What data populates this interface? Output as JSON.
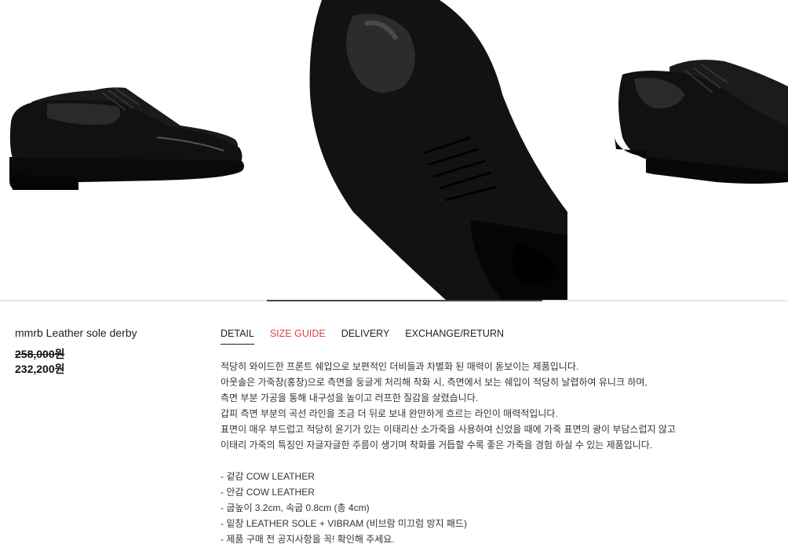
{
  "gallery": {
    "slides": [
      "shoe-side-view",
      "shoe-top-closeup",
      "shoe-angled-view"
    ],
    "progress": 0.35
  },
  "product": {
    "name": "mmrb Leather sole derby",
    "original_price": "258,000원",
    "sale_price": "232,200원"
  },
  "tabs": [
    {
      "label": "DETAIL",
      "active": true
    },
    {
      "label": "SIZE GUIDE",
      "highlight_color": "#d9473f"
    },
    {
      "label": "DELIVERY"
    },
    {
      "label": "EXCHANGE/RETURN"
    }
  ],
  "description": {
    "paragraphs": [
      "적당히 와이드한 프론트 쉐입으로 보편적인 더비들과 차별화 된 매력이 돋보이는 제품입니다.",
      "아웃솔은 가죽창(홍창)으로 측면을 둥글게 처리해 착화 시, 측면에서 보는 쉐입이 적당히 날렵하여 유니크 하며,",
      "측면 부분 가공을 통해 내구성을 높이고 러프한 질감을 살렸습니다.",
      "갑피 측면 부분의 곡선 라인을 조금 더 뒤로 보내 완만하게 흐르는 라인이 매력적입니다.",
      "표면이 매우 부드럽고 적당히 윤기가 있는 이태리산 소가죽을 사용하여 신었을 때에 가죽 표면의 광이 부담스럽지 않고",
      "이태리 가죽의 특징인 자글자글한 주름이 생기며 착화를 거듭할 수록 좋은 가죽을 경험 하실 수 있는 제품입니다."
    ],
    "specs": [
      "- 겉감 COW LEATHER",
      "- 안감 COW LEATHER",
      "- 굽높이 3.2cm, 속굽 0.8cm (총 4cm)",
      "- 밑창 LEATHER SOLE + VIBRAM (비브람 미끄럼 방지 패드)",
      "- 제품 구매 전 공지사항을 꼭! 확인해 주세요."
    ]
  },
  "colors": {
    "accent": "#d9473f",
    "shoe": "#111111",
    "progress": "#444444"
  }
}
